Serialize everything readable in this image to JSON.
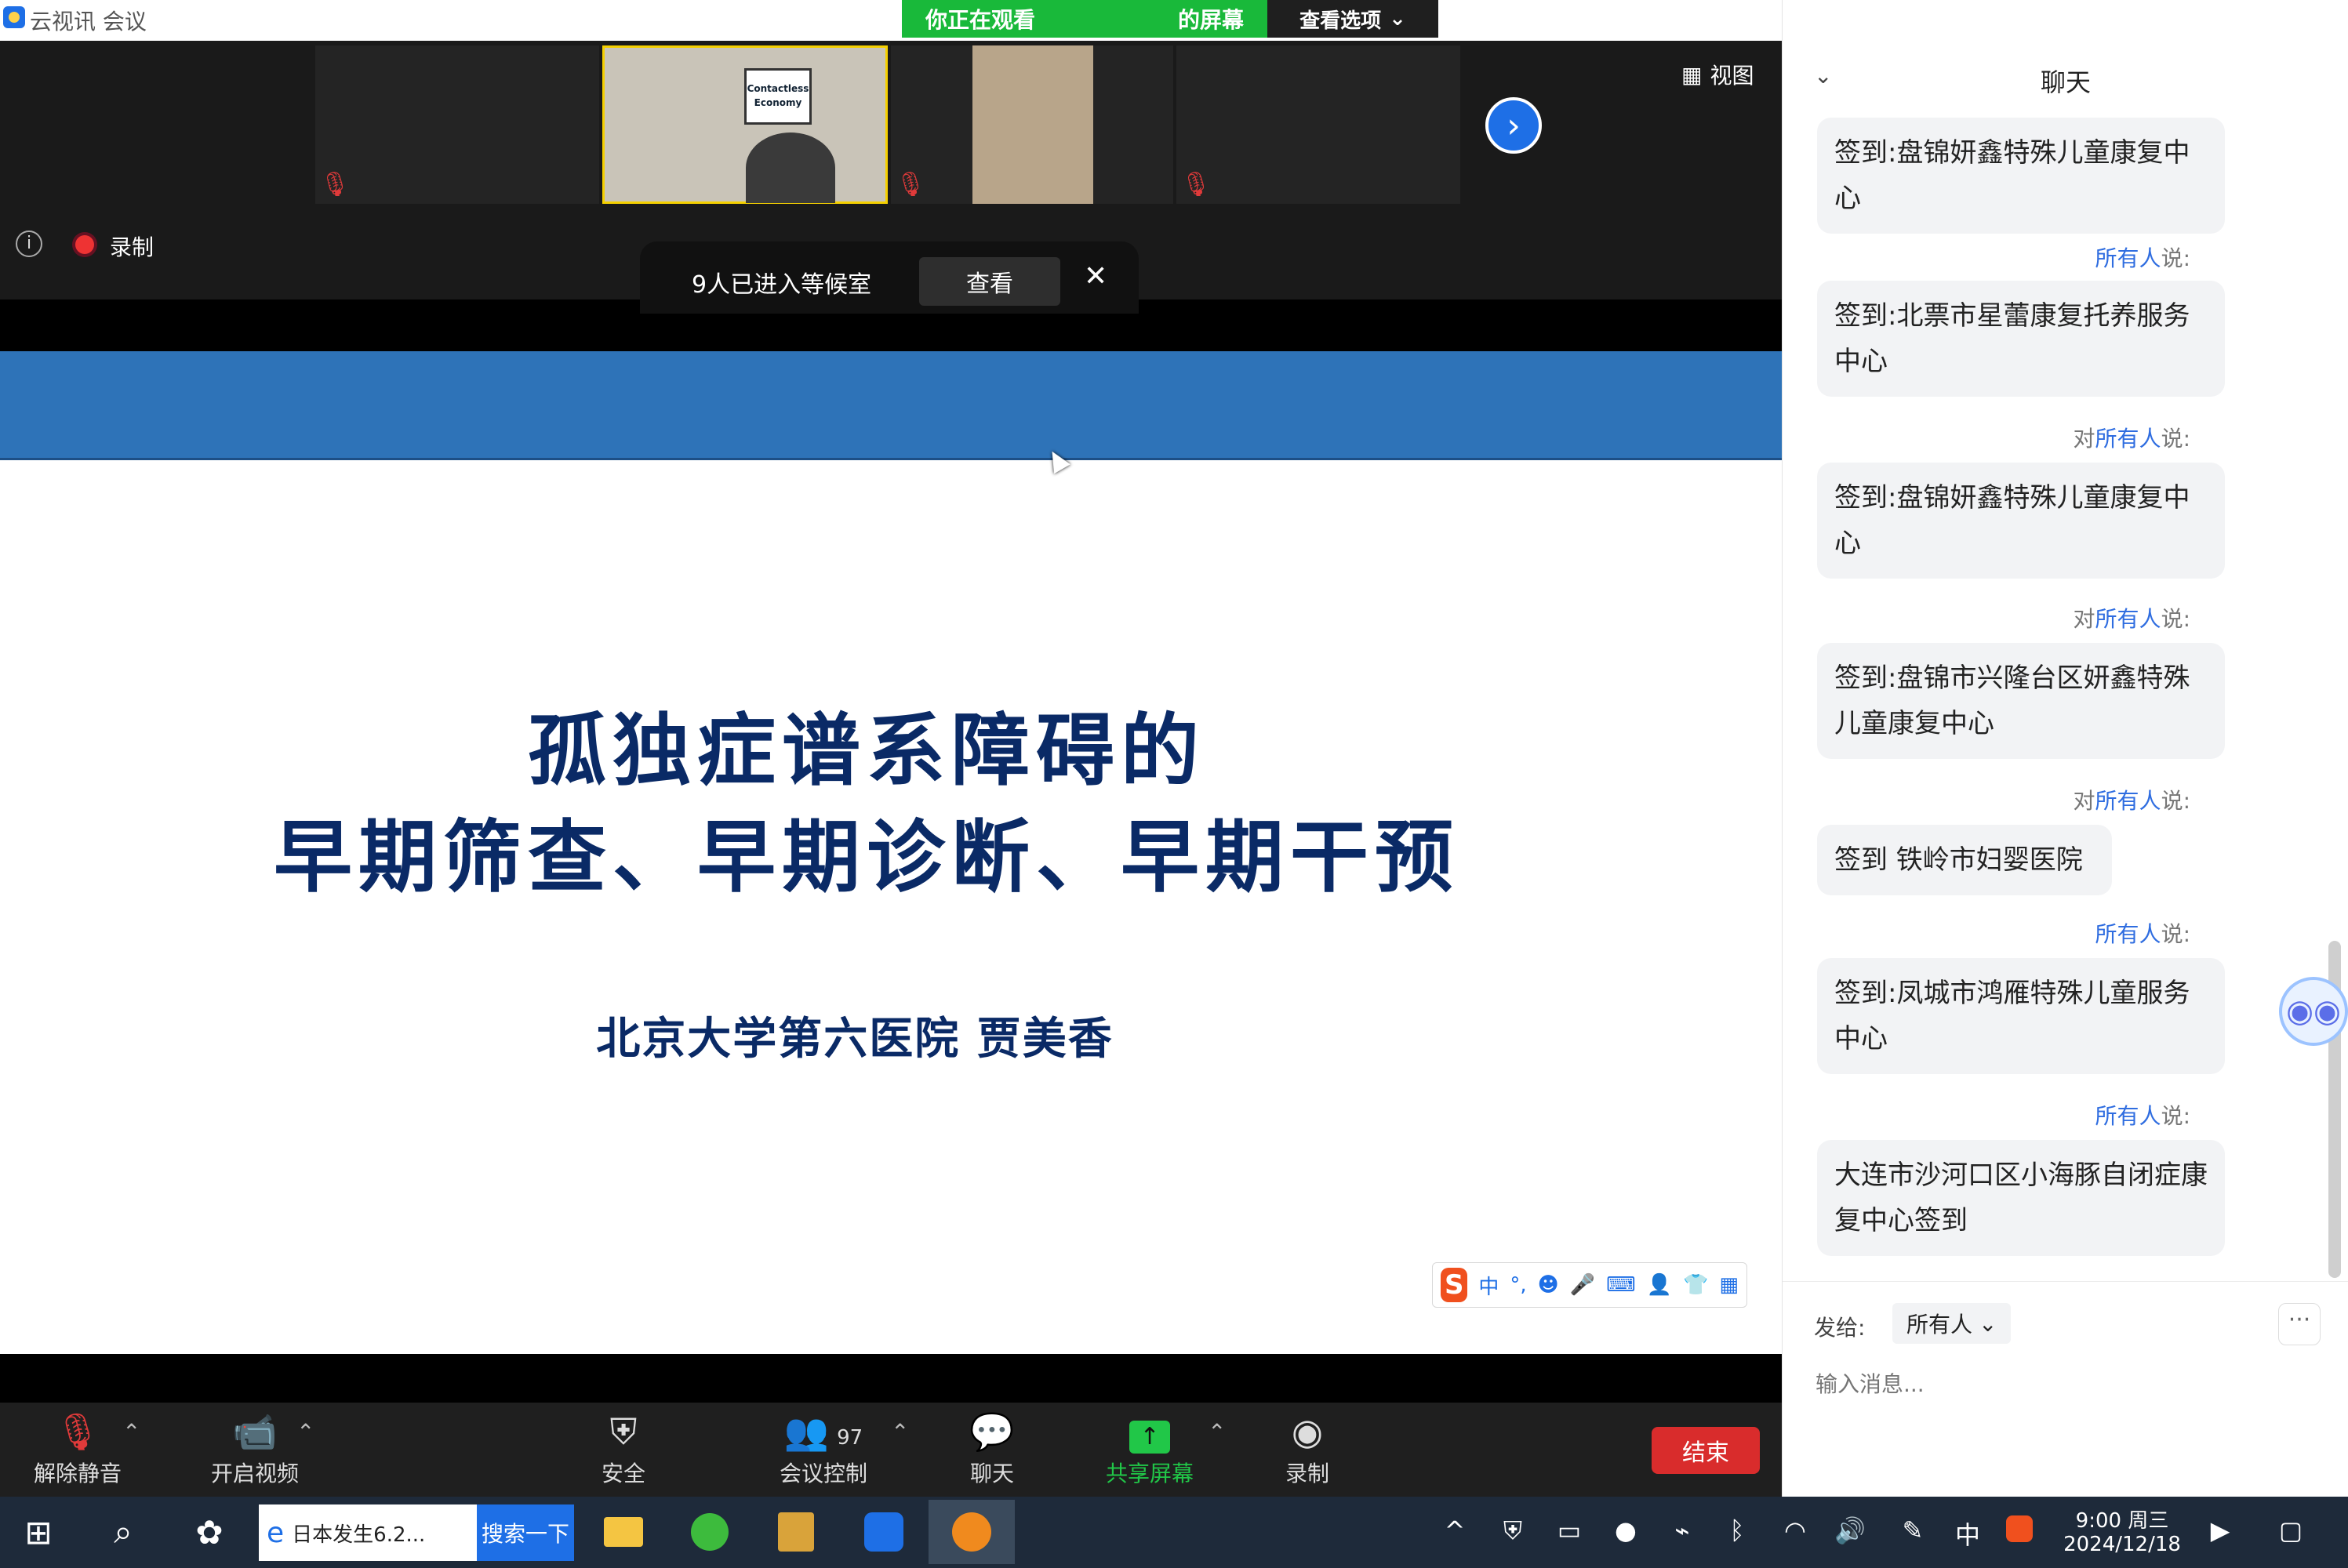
{
  "window": {
    "app_title": "云视讯 会议",
    "viewing_banner_prefix": "你正在观看",
    "viewing_banner_suffix": "的屏幕",
    "view_options_label": "查看选项",
    "win_minimize": "—",
    "win_restore": "❐",
    "win_close": "✕"
  },
  "video": {
    "view_label": "视图",
    "thumb_sign_line1": "Contactless",
    "thumb_sign_line2": "Economy",
    "record_label": "录制",
    "waiting_text": "9人已进入等候室",
    "waiting_view_label": "查看",
    "waiting_close": "✕"
  },
  "slide": {
    "title_line1": "孤独症谱系障碍的",
    "title_line2": "早期筛查、早期诊断、早期干预",
    "author": "北京大学第六医院   贾美香",
    "ime_logo": "S",
    "ime_mode": "中"
  },
  "toolbar": {
    "unmute": "解除静音",
    "start_video": "开启视频",
    "security": "安全",
    "participants_count": "97",
    "meeting_control": "会议控制",
    "chat": "聊天",
    "share_screen": "共享屏幕",
    "record": "录制",
    "end": "结束"
  },
  "chat": {
    "title": "聊天",
    "to_all_prefix": "对",
    "to_all_highlight": "所有人",
    "to_all_suffix": "说:",
    "messages": [
      "签到:盘锦妍鑫特殊儿童康复中心",
      "签到:北票市星蕾康复托养服务中心",
      "签到:盘锦妍鑫特殊儿童康复中心",
      "签到:盘锦市兴隆台区妍鑫特殊儿童康复中心",
      "签到  铁岭市妇婴医院",
      "签到:凤城市鸿雁特殊儿童服务中心",
      "大连市沙河口区小海豚自闭症康复中心签到"
    ],
    "send_to_label": "发给:",
    "send_to_value": "所有人",
    "input_placeholder": "输入消息..."
  },
  "taskbar": {
    "search_text": "日本发生6.2...",
    "search_button": "搜索一下",
    "ime_indicator": "中",
    "time": "9:00 周三",
    "date": "2024/12/18"
  },
  "colors": {
    "accent_blue": "#1e6fe6",
    "banner_green": "#19b93a",
    "slide_blue": "#2e73b8",
    "title_navy": "#0a2a66",
    "end_red": "#d92c2c"
  }
}
